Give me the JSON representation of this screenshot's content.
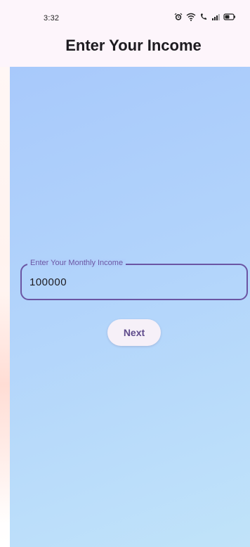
{
  "status_bar": {
    "time": "3:32",
    "icons": [
      "alarm-icon",
      "wifi-icon",
      "call-signal-icon",
      "signal-bars-icon",
      "battery-icon"
    ]
  },
  "header": {
    "title": "Enter Your Income"
  },
  "form": {
    "income_field": {
      "label": "Enter Your Monthly Income",
      "value": "100000"
    },
    "next_label": "Next"
  },
  "colors": {
    "accent": "#6b55a3",
    "background_gradient_start": "#a8c9fb",
    "background_gradient_end": "#c0e3f9",
    "app_bar": "#fdf5fb",
    "button_bg": "#f6f0f8"
  }
}
